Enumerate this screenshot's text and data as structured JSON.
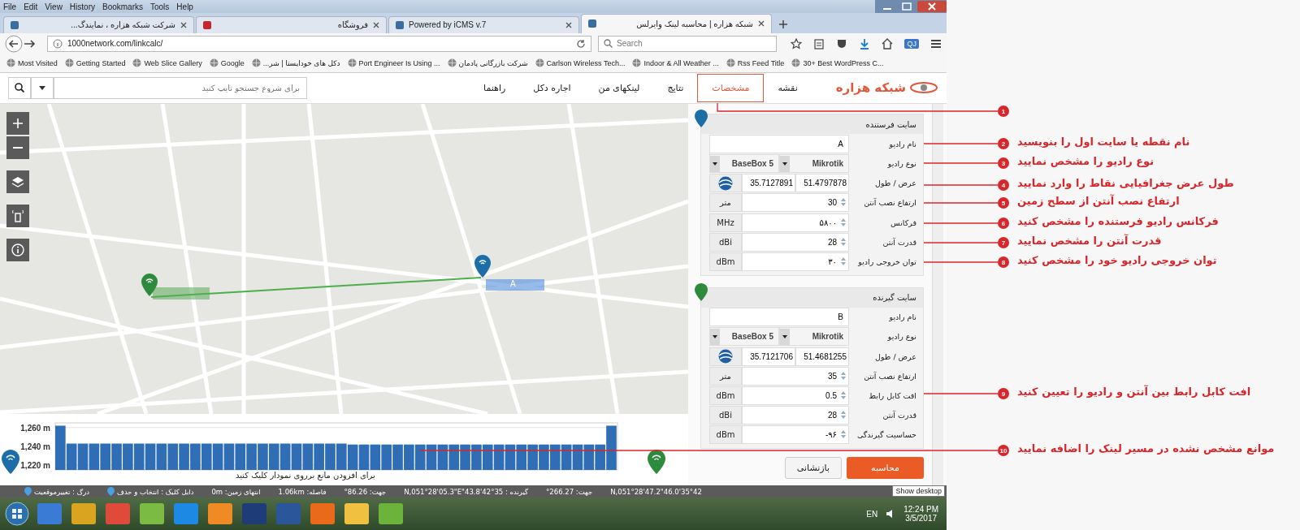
{
  "menu": [
    "Help",
    "Tools",
    "Bookmarks",
    "History",
    "View",
    "Edit",
    "File"
  ],
  "tabs": [
    {
      "title": "شبکه هزاره | محاسبه لینک وایرلس",
      "selected": true
    },
    {
      "title": "Powered by iCMS v.7",
      "selected": false
    },
    {
      "title": "فروشگاه",
      "selected": false
    },
    {
      "title": "شرکت شبکه هزاره ، نمایندگ...",
      "selected": false
    }
  ],
  "address_bar": {
    "url": "1000network.com/linkcalc/"
  },
  "search_box": {
    "placeholder": "Search"
  },
  "account_badge": "QJ",
  "bookmarks": [
    "30+ Best WordPress C...",
    "Rss Feed Title",
    "Indoor & All Weather ...",
    "Carlson Wireless Tech...",
    "شرکت بازرگانی پادمان",
    "Port Engineer Is Using ...",
    "دکل های خودایستا | شر...",
    "Google",
    "Web Slice Gallery",
    "Getting Started",
    "Most Visited"
  ],
  "site": {
    "logo": "شبکه هزاره",
    "nav": [
      {
        "label": "نقشه",
        "selected": false
      },
      {
        "label": "مشخصات",
        "selected": true
      },
      {
        "label": "نتایج",
        "selected": false
      },
      {
        "label": "لینکهای من",
        "selected": false
      },
      {
        "label": "اجاره دکل",
        "selected": false
      },
      {
        "label": "راهنما",
        "selected": false
      }
    ],
    "search": {
      "placeholder": "برای شروع جستجو تایپ کنید"
    }
  },
  "map": {
    "marker_label": "A"
  },
  "sites": [
    {
      "title": "سایت فرستنده",
      "color": "#1b6ea8",
      "rows": [
        {
          "kind": "text",
          "label": "نام رادیو",
          "value": "A"
        },
        {
          "kind": "select",
          "label": "نوع رادیو",
          "values": [
            "Mikrotik",
            "BaseBox 5"
          ]
        },
        {
          "kind": "coords",
          "label": "عرض / طول",
          "values": [
            "51.4797878",
            "35.7127891"
          ]
        },
        {
          "kind": "number",
          "label": "ارتفاع نصب آنتن",
          "value": "30",
          "unit": "متر"
        },
        {
          "kind": "number",
          "label": "فرکانس",
          "value": "۵۸۰۰",
          "unit": "MHz"
        },
        {
          "kind": "number",
          "label": "قدرت آنتن",
          "value": "28",
          "unit": "dBi"
        },
        {
          "kind": "number",
          "label": "توان خروجی رادیو",
          "value": "۳۰",
          "unit": "dBm"
        }
      ]
    },
    {
      "title": "سایت گیرنده",
      "color": "#2e8b3e",
      "rows": [
        {
          "kind": "text",
          "label": "نام رادیو",
          "value": "B"
        },
        {
          "kind": "select",
          "label": "نوع رادیو",
          "values": [
            "Mikrotik",
            "BaseBox 5"
          ]
        },
        {
          "kind": "coords",
          "label": "عرض / طول",
          "values": [
            "51.4681255",
            "35.7121706"
          ]
        },
        {
          "kind": "number",
          "label": "ارتفاع نصب آنتن",
          "value": "35",
          "unit": "متر"
        },
        {
          "kind": "number",
          "label": "افت کابل رابط",
          "value": "0.5",
          "unit": "dBm"
        },
        {
          "kind": "number",
          "label": "قدرت آنتن",
          "value": "28",
          "unit": "dBi"
        },
        {
          "kind": "number",
          "label": "حساسیت گیرندگی",
          "value": "-۹۶",
          "unit": "dBm"
        }
      ]
    }
  ],
  "buttons": [
    {
      "label": "محاسبه",
      "kind": "primary"
    },
    {
      "label": "بازنشانی",
      "kind": "secondary"
    }
  ],
  "profile": {
    "hint": "برای افزودن مانع برروی نمودار کلیک کنید",
    "chart_data": {
      "type": "bar",
      "grid": true,
      "ylim": [
        1215,
        1265
      ],
      "yticks": [
        {
          "value": 1220,
          "label": "1,220 m"
        },
        {
          "value": 1240,
          "label": "1,240 m"
        },
        {
          "value": 1260,
          "label": "1,260 m"
        }
      ],
      "values": [
        1262,
        1243,
        1243,
        1243,
        1243,
        1243,
        1243,
        1243,
        1243,
        1243,
        1243,
        1243,
        1243,
        1243,
        1243,
        1243,
        1243,
        1243,
        1243,
        1243,
        1243,
        1243,
        1243,
        1243,
        1243,
        1243,
        1242,
        1242,
        1242,
        1242,
        1242,
        1242,
        1242,
        1242,
        1242,
        1242,
        1242,
        1242,
        1242,
        1242,
        1242,
        1242,
        1242,
        1242,
        1242,
        1242,
        1242,
        1242,
        1242,
        1262
      ]
    }
  },
  "status_bar": [
    {
      "kind": "info",
      "text": "35°42'46.0\"N,051°28'47.2"
    },
    {
      "kind": "info",
      "text": "جهت: 266.27°"
    },
    {
      "kind": "info",
      "text": "گیرنده : 35°42'43.8\"N,051°28'05.3\"E"
    },
    {
      "kind": "info",
      "text": "جهت: 86.26°"
    },
    {
      "kind": "info",
      "text": "فاصله: 1.06km"
    },
    {
      "kind": "info",
      "text": "انتهای زمین: 0m"
    },
    {
      "kind": "hint",
      "text": "دابل کلیک : انتخاب و حذف"
    },
    {
      "kind": "hint",
      "text": "درگ : تغییرموقعیت"
    }
  ],
  "taskbar": {
    "language": "EN",
    "time": "12:24 PM",
    "date": "3/5/2017",
    "tooltip": "Show desktop"
  },
  "annotations": [
    {
      "number": "1"
    },
    {
      "number": "2",
      "text": "نام نقطه یا سایت اول را بنویسید"
    },
    {
      "number": "3",
      "text": "نوع رادیو را مشخص نمایید"
    },
    {
      "number": "4",
      "text": "طول عرض جغرافیایی نقاط را وارد نمایید"
    },
    {
      "number": "5",
      "text": "ارتفاع نصب آنتن از سطح زمین"
    },
    {
      "number": "6",
      "text": "فرکانس رادیو فرستنده را مشخص کنید"
    },
    {
      "number": "7",
      "text": "قدرت آنتن را مشخص نمایید"
    },
    {
      "number": "8",
      "text": "توان خروجی رادیو خود را مشخص کنید"
    },
    {
      "number": "9",
      "text": "افت کابل رابط بین آنتن و رادیو را تعیین کنید"
    },
    {
      "number": "10",
      "text": "موانع مشخص نشده در مسیر لینک را اضافه نمایید"
    }
  ]
}
